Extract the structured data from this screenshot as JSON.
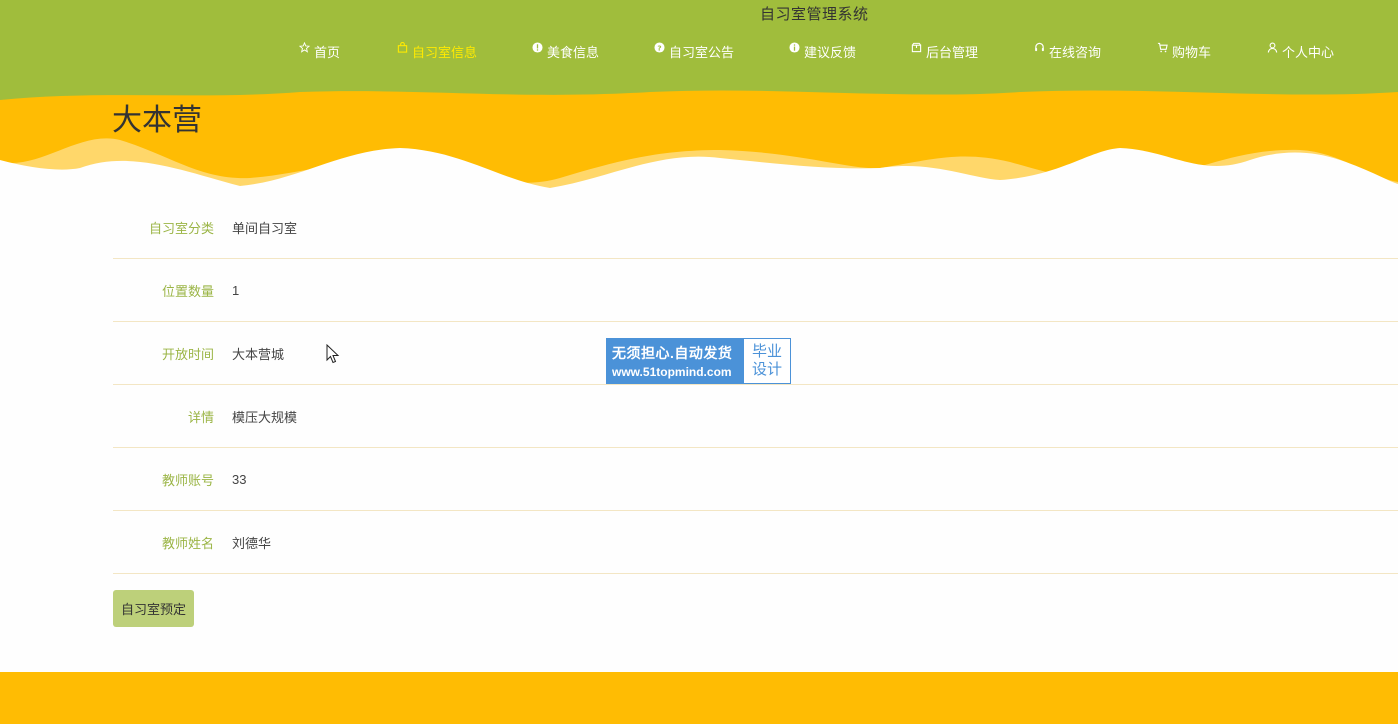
{
  "site": {
    "title": "自习室管理系统"
  },
  "nav": {
    "items": [
      {
        "label": "首页",
        "icon": "star-icon"
      },
      {
        "label": "自习室信息",
        "icon": "bag-icon",
        "active": true
      },
      {
        "label": "美食信息",
        "icon": "alert-circle-icon"
      },
      {
        "label": "自习室公告",
        "icon": "question-circle-icon"
      },
      {
        "label": "建议反馈",
        "icon": "info-circle-icon"
      },
      {
        "label": "后台管理",
        "icon": "box-icon"
      },
      {
        "label": "在线咨询",
        "icon": "headset-icon"
      },
      {
        "label": "购物车",
        "icon": "cart-icon"
      },
      {
        "label": "个人中心",
        "icon": "user-icon"
      }
    ]
  },
  "page": {
    "heading": "大本营"
  },
  "details": [
    {
      "label": "自习室分类",
      "value": "单间自习室"
    },
    {
      "label": "位置数量",
      "value": "1"
    },
    {
      "label": "开放时间",
      "value": "大本营城"
    },
    {
      "label": "详情",
      "value": "模压大规模"
    },
    {
      "label": "教师账号",
      "value": "33"
    },
    {
      "label": "教师姓名",
      "value": "刘德华"
    }
  ],
  "actions": {
    "book_label": "自习室预定"
  },
  "watermark": {
    "line1": "无须担心.自动发货",
    "line2": "www.51topmind.com",
    "side1": "毕业",
    "side2": "设计"
  },
  "colors": {
    "header_green": "#a0bd3c",
    "wave_orange": "#ffbc03",
    "wave_light": "#ffd76a",
    "label_green": "#9bb546",
    "active_nav": "#ffea00",
    "button_bg": "#bdd07a"
  }
}
